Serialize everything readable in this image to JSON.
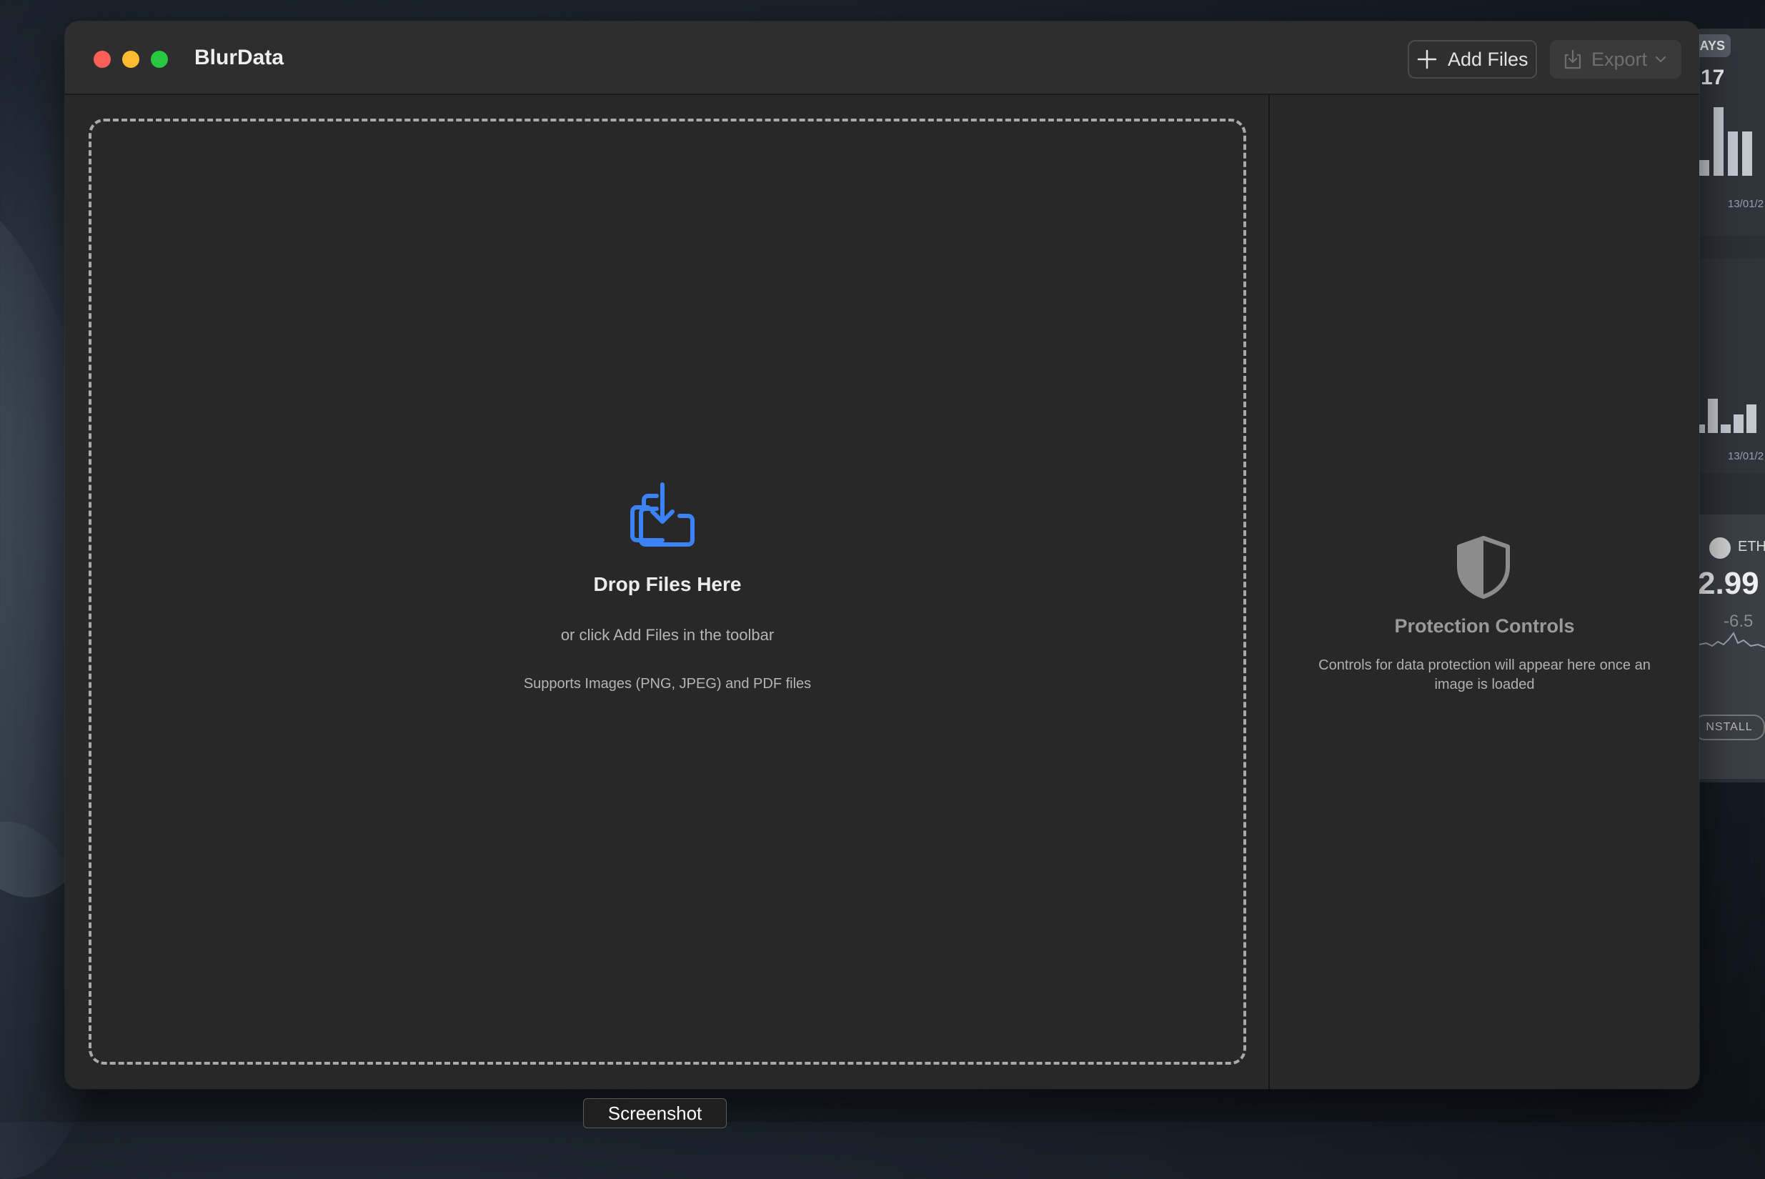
{
  "window": {
    "app_title": "BlurData",
    "toolbar": {
      "add_files_label": "Add Files",
      "export_label": "Export"
    }
  },
  "drop_zone": {
    "title": "Drop Files Here",
    "subtitle": "or click Add Files in the toolbar",
    "supported": "Supports Images (PNG, JPEG) and PDF files"
  },
  "protection_panel": {
    "title": "Protection Controls",
    "description": "Controls for data protection will appear here once an image is loaded"
  },
  "tooltip": "Screenshot",
  "background_app": {
    "tag": "AYS",
    "count": "17",
    "date_1": "13/01/2",
    "date_2": "13/01/2",
    "coin_label": "ETH",
    "price": "2.99",
    "change": "-6.5",
    "install": "NSTALL"
  },
  "colors": {
    "accent": "#3b82f6",
    "window_bg": "#282828",
    "titlebar_bg": "#2e2e2e"
  }
}
